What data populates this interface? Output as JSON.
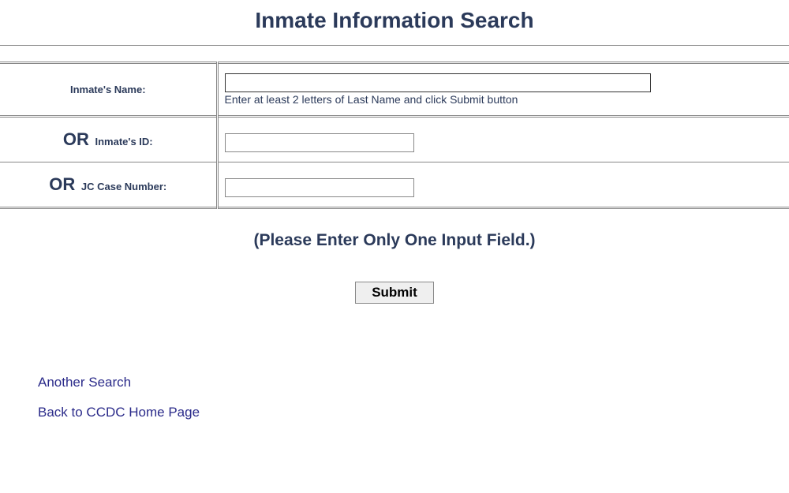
{
  "header": {
    "title": "Inmate Information Search"
  },
  "form": {
    "rows": [
      {
        "or_prefix": "",
        "label": "Inmate's Name:",
        "hint": "Enter at least 2 letters of Last Name and click Submit button",
        "value": ""
      },
      {
        "or_prefix": "OR",
        "label": " Inmate's ID:",
        "hint": "",
        "value": ""
      },
      {
        "or_prefix": "OR",
        "label": " JC Case Number:",
        "hint": "",
        "value": ""
      }
    ],
    "instruction": "(Please Enter Only One Input Field.)",
    "submit_label": "Submit"
  },
  "links": {
    "another_search": "Another Search",
    "back_home": "Back to CCDC Home Page"
  }
}
